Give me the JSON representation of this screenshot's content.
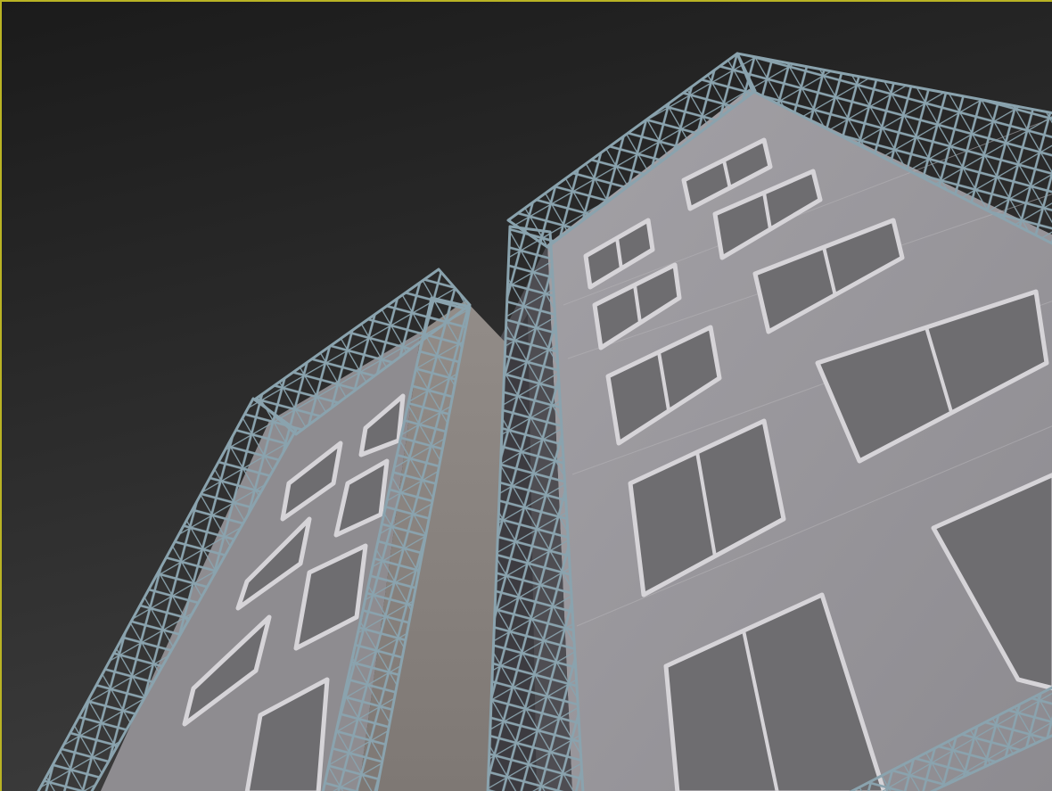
{
  "viewport": {
    "border_color": "#b9b324",
    "sky_top": "#1b1b1b",
    "sky_bottom": "#3a3a3a",
    "facade_color": "#959397",
    "truss_color": "#8aa3ae",
    "window_glass": "#6e6d70",
    "window_frame": "#d6d4d8"
  }
}
